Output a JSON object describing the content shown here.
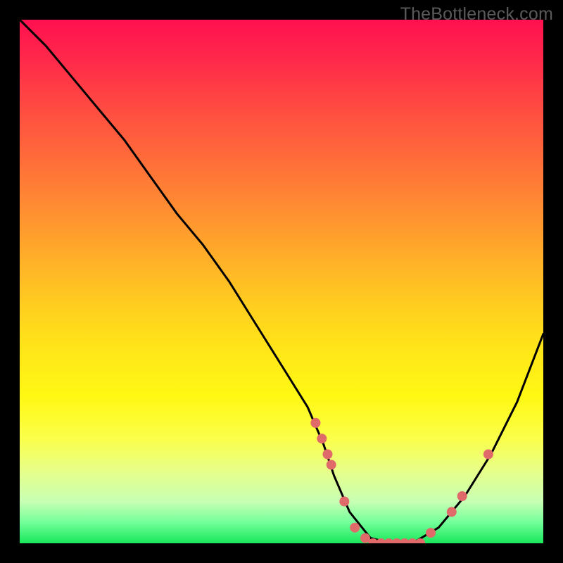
{
  "watermark": "TheBottleneck.com",
  "chart_data": {
    "type": "line",
    "title": "",
    "xlabel": "",
    "ylabel": "",
    "xlim": [
      0,
      100
    ],
    "ylim": [
      0,
      100
    ],
    "grid": false,
    "series": [
      {
        "name": "bottleneck-curve",
        "color": "#000000",
        "x": [
          0,
          5,
          10,
          15,
          20,
          25,
          30,
          35,
          40,
          45,
          50,
          55,
          58,
          60,
          63,
          67,
          71,
          75,
          80,
          85,
          90,
          95,
          100
        ],
        "y": [
          100,
          95,
          89,
          83,
          77,
          70,
          63,
          57,
          50,
          42,
          34,
          26,
          19,
          13,
          6,
          1,
          0,
          0,
          3,
          9,
          17,
          27,
          40
        ]
      }
    ],
    "markers": {
      "name": "gpu-points",
      "color": "#e06a6a",
      "radius": 7,
      "points": [
        {
          "x": 56.5,
          "y": 23
        },
        {
          "x": 57.7,
          "y": 20
        },
        {
          "x": 58.8,
          "y": 17
        },
        {
          "x": 59.5,
          "y": 15
        },
        {
          "x": 62.0,
          "y": 8
        },
        {
          "x": 64.0,
          "y": 3
        },
        {
          "x": 66.0,
          "y": 1
        },
        {
          "x": 67.5,
          "y": 0
        },
        {
          "x": 69.0,
          "y": 0
        },
        {
          "x": 70.5,
          "y": 0
        },
        {
          "x": 72.0,
          "y": 0
        },
        {
          "x": 73.5,
          "y": 0
        },
        {
          "x": 75.0,
          "y": 0
        },
        {
          "x": 76.5,
          "y": 0
        },
        {
          "x": 78.5,
          "y": 2
        },
        {
          "x": 82.5,
          "y": 6
        },
        {
          "x": 84.5,
          "y": 9
        },
        {
          "x": 89.5,
          "y": 17
        }
      ]
    },
    "gradient_stops": [
      {
        "pos": 0,
        "color": "#ff1050"
      },
      {
        "pos": 50,
        "color": "#ffc024"
      },
      {
        "pos": 80,
        "color": "#f6ff3c"
      },
      {
        "pos": 100,
        "color": "#18e75a"
      }
    ]
  }
}
